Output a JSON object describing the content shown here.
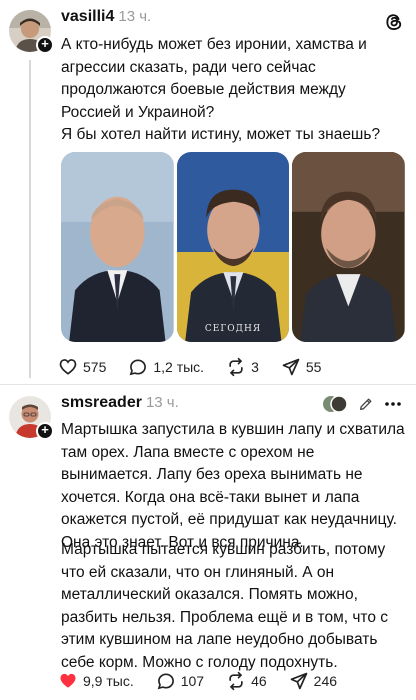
{
  "post": {
    "author": "vasilli4",
    "time": "13 ч.",
    "paragraph_1": "А кто-нибудь может без иронии, хамства и агрессии сказать, ради чего сейчас продолжаются боевые действия между Россией и Украиной?",
    "paragraph_2": "Я бы хотел найти истину, может ты знаешь?",
    "photo_caption": "СЕГОДНЯ",
    "likes": "575",
    "comments": "1,2 тыс.",
    "reposts": "3",
    "shares": "55"
  },
  "reply": {
    "author": "smsreader",
    "time": "13 ч.",
    "paragraph_1": "Мартышка запустила в кувшин лапу и схватила там орех. Лапа вместе с орехом не вынимается. Лапу без ореха вынимать не хочется. Когда она всё-таки вынет и лапа окажется пустой, её придушат как неудачницу. Она это знает. Вот и вся причина.",
    "paragraph_2": "Мартышка пытается кувшин разбить, потому что ей сказали, что он глиняный. А он металлический оказался. Помять можно, разбить нельзя. Проблема ещё и в том, что с этим кувшином на лапе неудобно добывать себе корм. Можно с голоду подохнуть.",
    "likes": "9,9 тыс.",
    "comments": "107",
    "reposts": "46",
    "shares": "246"
  },
  "colors": {
    "like_active": "#ff3040",
    "muted": "#9a9a9a",
    "text": "#111111"
  }
}
